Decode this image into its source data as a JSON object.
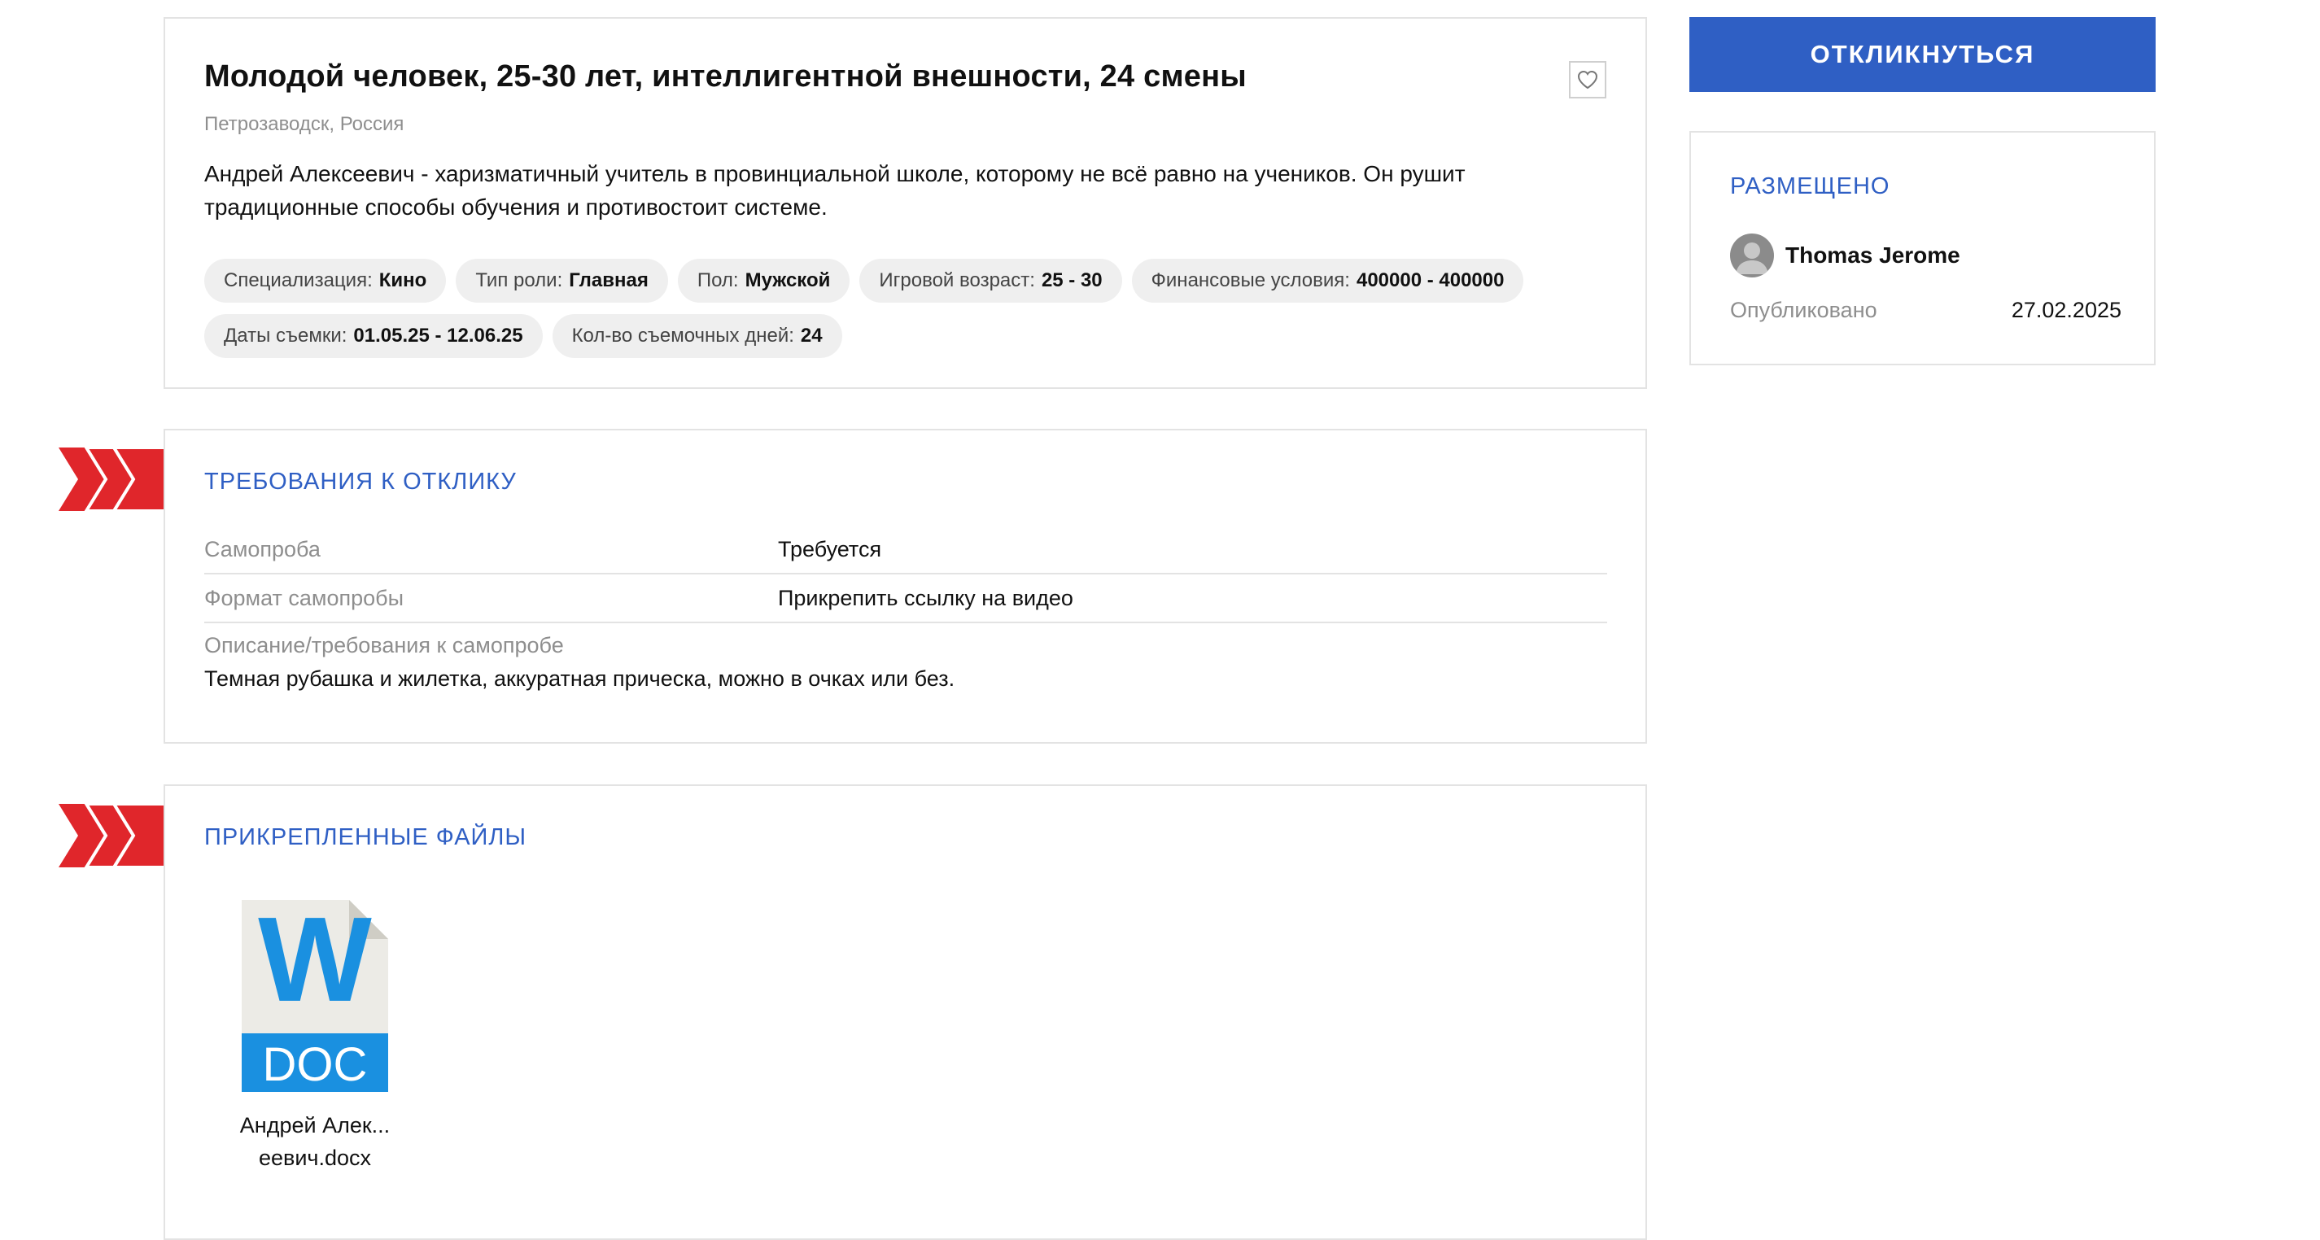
{
  "vacancy": {
    "title": "Молодой человек, 25-30 лет, интеллигентной внешности, 24 смены",
    "location": "Петрозаводск, Россия",
    "description": "Андрей Алексеевич - харизматичный учитель в провинциальной школе, которому не всё равно на учеников. Он рушит традиционные способы обучения и противостоит системе.",
    "favorite_icon": "heart-icon",
    "tags": [
      {
        "label": "Специализация:",
        "value": "Кино"
      },
      {
        "label": "Тип роли:",
        "value": "Главная"
      },
      {
        "label": "Пол:",
        "value": "Мужской"
      },
      {
        "label": "Игровой возраст:",
        "value": "25 - 30"
      },
      {
        "label": "Финансовые условия:",
        "value": "400000 - 400000"
      },
      {
        "label": "Даты съемки:",
        "value": "01.05.25 - 12.06.25"
      },
      {
        "label": "Кол-во съемочных дней:",
        "value": "24"
      }
    ]
  },
  "requirements": {
    "title": "ТРЕБОВАНИЯ К ОТКЛИКУ",
    "rows": [
      {
        "label": "Самопроба",
        "value": "Требуется"
      },
      {
        "label": "Формат самопробы",
        "value": "Прикрепить ссылку на видео"
      }
    ],
    "desc_label": "Описание/требования к самопробе",
    "desc_value": "Темная рубашка и жилетка, аккуратная прическа, можно в очках или без."
  },
  "files": {
    "title": "ПРИКРЕПЛЕННЫЕ ФАЙЛЫ",
    "items": [
      {
        "icon": "doc-file-icon",
        "badge": "DOC",
        "letter": "W",
        "name_line1": "Андрей Алек...",
        "name_line2": "еевич.docx"
      }
    ]
  },
  "sidebar": {
    "respond_label": "ОТКЛИКНУТЬСЯ",
    "posted_title": "РАЗМЕЩЕНО",
    "author_name": "Thomas Jerome",
    "published_label": "Опубликовано",
    "published_date": "27.02.2025"
  },
  "colors": {
    "accent": "#2f5fc4",
    "chevron": "#e0262b",
    "muted": "#8e8e8e",
    "doc_blue": "#1a90e0"
  }
}
